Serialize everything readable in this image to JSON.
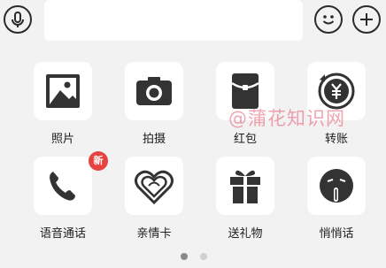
{
  "topbar": {
    "voice_icon": "microphone-icon",
    "emoji_icon": "smiley-icon",
    "more_icon": "plus-icon"
  },
  "items": [
    {
      "label": "照片",
      "icon": "photo-icon"
    },
    {
      "label": "拍摄",
      "icon": "camera-icon"
    },
    {
      "label": "红包",
      "icon": "red-packet-icon"
    },
    {
      "label": "转账",
      "icon": "transfer-icon"
    },
    {
      "label": "语音通话",
      "icon": "phone-icon",
      "badge": "新"
    },
    {
      "label": "亲情卡",
      "icon": "family-card-icon"
    },
    {
      "label": "送礼物",
      "icon": "gift-icon"
    },
    {
      "label": "悄悄话",
      "icon": "whisper-icon"
    }
  ],
  "watermark": "@蒲花知识网",
  "pager": {
    "current_page": 1,
    "page_count": 2
  },
  "colors": {
    "background": "#f2f2f2",
    "tile": "#ffffff",
    "icon": "#333333",
    "badge": "#e64340"
  }
}
